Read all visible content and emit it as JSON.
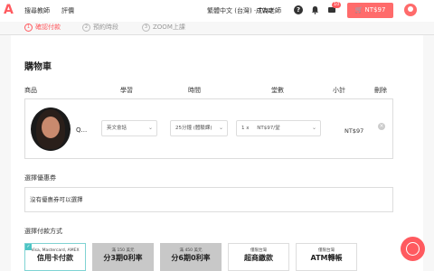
{
  "header": {
    "logo": "A",
    "nav": [
      "搜尋教師",
      "評價"
    ],
    "language": "繁體中文 (台灣) · TWD",
    "become_teacher": "成為老師",
    "help_glyph": "?",
    "message_count": "10",
    "cart_label": "NT$97"
  },
  "steps": [
    {
      "num": "1",
      "label": "確認付款"
    },
    {
      "num": "2",
      "label": "預約時段"
    },
    {
      "num": "3",
      "label": "ZOOM上課"
    }
  ],
  "cart": {
    "title": "購物車",
    "columns": [
      "商品",
      "學習",
      "時間",
      "堂數",
      "小計",
      "刪除"
    ],
    "item": {
      "tutor_name": "Q...",
      "subject": "英文會話",
      "duration": "25分鐘 (體驗課)",
      "lessons": "1 x",
      "price_per": "NT$97/堂",
      "subtotal": "NT$97",
      "delete_glyph": "×"
    }
  },
  "coupon": {
    "label": "選擇優惠券",
    "value": "沒有優惠券可以選擇"
  },
  "payment": {
    "label": "選擇付款方式",
    "options": [
      {
        "sub": "Visa, Mastercard, AMEX",
        "main": "信用卡付款"
      },
      {
        "sub": "滿 150 美元",
        "main": "分3期0利率"
      },
      {
        "sub": "滿 450 美元",
        "main": "分6期0利率"
      },
      {
        "sub": "僅限台灣",
        "main": "超商繳款"
      },
      {
        "sub": "僅限台灣",
        "main": "ATM轉帳"
      }
    ]
  },
  "colors": {
    "accent": "#ff5a5f",
    "selected": "#4cc4c4"
  }
}
